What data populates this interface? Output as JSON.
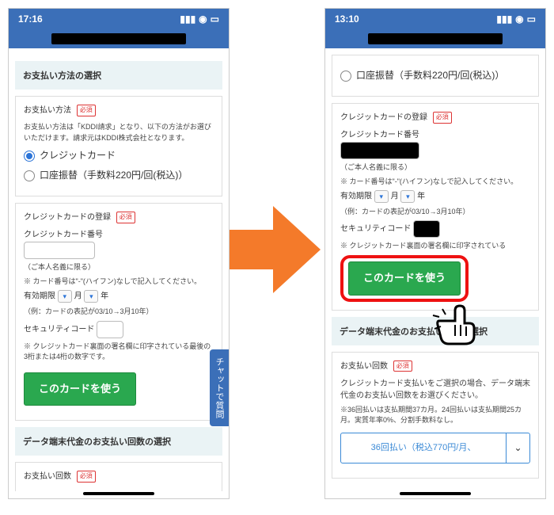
{
  "left": {
    "time": "17:16",
    "section_payment_method": "お支払い方法の選択",
    "payment_method_label": "お支払い方法",
    "required": "必須",
    "payment_method_note": "お支払い方法は「KDDI請求」となり、以下の方法がお選びいただけます。請求元はKDDI株式会社となります。",
    "radio_credit": "クレジットカード",
    "radio_bank": "口座振替（手数料220円/回(税込)）",
    "cc_register_label": "クレジットカードの登録",
    "cc_number_label": "クレジットカード番号",
    "cc_name_note": "（ご本人名義に限る）",
    "cc_hyphen_note": "※ カード番号は\"-\"(ハイフン)なしで記入してください。",
    "expiry_label": "有効期限",
    "month_unit": "月",
    "year_unit": "年",
    "expiry_example": "（例：カードの表記が03/10→3月10年）",
    "security_label": "セキュリティコード",
    "security_note": "※ クレジットカード裏面の署名欄に印字されている最後の3桁または4桁の数字です。",
    "use_card_btn": "このカードを使う",
    "section_device_pay": "データ端末代金のお支払い回数の選択",
    "pay_count_label": "お支払い回数",
    "chat_tab": "チャットで質問"
  },
  "right": {
    "time": "13:10",
    "radio_bank": "口座振替（手数料220円/回(税込)）",
    "cc_register_label": "クレジットカードの登録",
    "required": "必須",
    "cc_number_label": "クレジットカード番号",
    "cc_name_note": "（ご本人名義に限る）",
    "cc_hyphen_note": "※ カード番号は\"-\"(ハイフン)なしで記入してください。",
    "expiry_label": "有効期限",
    "month_unit": "月",
    "year_unit": "年",
    "expiry_example": "（例：カードの表記が03/10→3月10年）",
    "security_label": "セキュリティコード",
    "security_note": "※ クレジットカード裏面の署名欄に印字されている",
    "use_card_btn": "このカードを使う",
    "section_device_pay": "データ端末代金のお支払い回数の選択",
    "pay_count_label": "お支払い回数",
    "pay_count_note1": "クレジットカード支払いをご選択の場合、データ端末代金のお支払い回数をお選びください。",
    "pay_count_note2": "※36回払いは支払期間37カ月。24回払いは支払期間25カ月。実質年率0%、分割手数料なし。",
    "select_option": "36回払い（税込770円/月、"
  }
}
